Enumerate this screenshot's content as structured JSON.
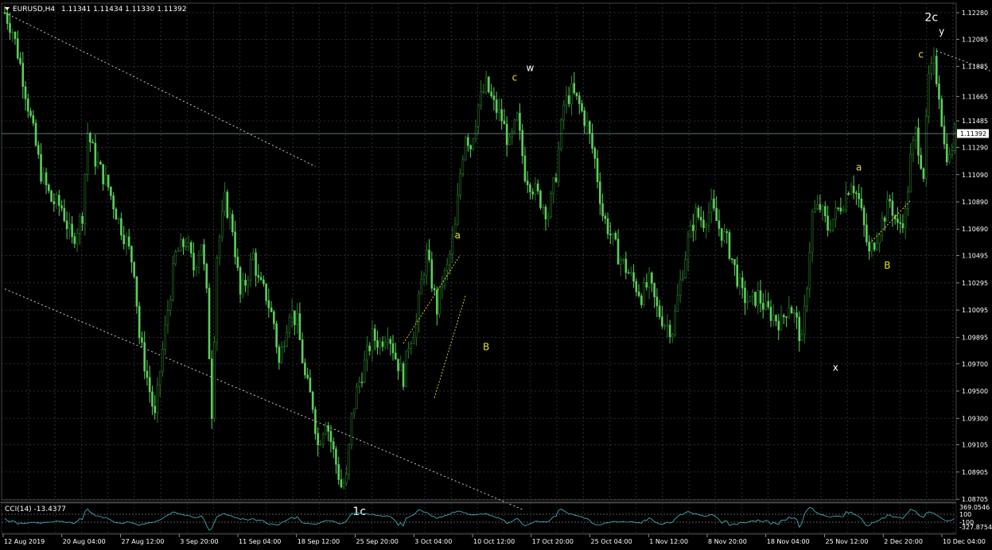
{
  "header": {
    "symbol_label": "EURUSD,H4",
    "ohlc": "1.11341 1.11434 1.11330 1.11392"
  },
  "indicator": {
    "label": "CCI(14) -13.4377",
    "top_value": "369.0546",
    "level_hi": "100",
    "level_lo": "-100",
    "bottom_value": "-327.8754",
    "color": "#4ab8c8"
  },
  "colors": {
    "background": "#000000",
    "grid": "#3a3a3a",
    "bull_candle": "#2a7a2a",
    "bear_candle": "#5ccf5c",
    "text": "#ffffff",
    "wave_minor": "#e8e030",
    "wave_major": "#ffffff"
  },
  "chart_data": {
    "type": "candlestick",
    "symbol": "EURUSD",
    "timeframe": "H4",
    "last_price": "1.11392",
    "ylim": [
      1.087,
      1.1235
    ],
    "y_ticks": [
      "1.12280",
      "1.12085",
      "1.11885",
      "1.11665",
      "1.11485",
      "1.11290",
      "1.11090",
      "1.10890",
      "1.10690",
      "1.10495",
      "1.10295",
      "1.10095",
      "1.09895",
      "1.09700",
      "1.09500",
      "1.09300",
      "1.09105",
      "1.08905",
      "1.08705"
    ],
    "x_ticks": [
      "12 Aug 2019",
      "20 Aug 04:00",
      "27 Aug 12:00",
      "3 Sep 20:00",
      "11 Sep 04:00",
      "18 Sep 12:00",
      "25 Sep 20:00",
      "3 Oct 04:00",
      "10 Oct 12:00",
      "17 Oct 20:00",
      "25 Oct 04:00",
      "1 Nov 12:00",
      "8 Nov 20:00",
      "18 Nov 04:00",
      "25 Nov 12:00",
      "2 Dec 20:00",
      "10 Dec 04:00"
    ],
    "price_path": [
      [
        0,
        1.1228
      ],
      [
        3,
        1.1215
      ],
      [
        6,
        1.119
      ],
      [
        10,
        1.115
      ],
      [
        14,
        1.111
      ],
      [
        18,
        1.109
      ],
      [
        22,
        1.1085
      ],
      [
        26,
        1.106
      ],
      [
        30,
        1.108
      ],
      [
        32,
        1.114
      ],
      [
        35,
        1.112
      ],
      [
        40,
        1.11
      ],
      [
        44,
        1.1075
      ],
      [
        47,
        1.106
      ],
      [
        50,
        1.104
      ],
      [
        52,
        1.099
      ],
      [
        55,
        1.096
      ],
      [
        58,
        1.093
      ],
      [
        60,
        1.0965
      ],
      [
        63,
        1.101
      ],
      [
        66,
        1.105
      ],
      [
        70,
        1.106
      ],
      [
        73,
        1.104
      ],
      [
        76,
        1.106
      ],
      [
        78,
        1.102
      ],
      [
        80,
        1.0935
      ],
      [
        82,
        1.105
      ],
      [
        85,
        1.109
      ],
      [
        88,
        1.107
      ],
      [
        91,
        1.102
      ],
      [
        93,
        1.103
      ],
      [
        96,
        1.105
      ],
      [
        98,
        1.103
      ],
      [
        101,
        1.102
      ],
      [
        104,
        1.1
      ],
      [
        106,
        1.097
      ],
      [
        110,
        1.101
      ],
      [
        113,
        1.1
      ],
      [
        116,
        1.096
      ],
      [
        119,
        1.094
      ],
      [
        121,
        1.091
      ],
      [
        124,
        1.093
      ],
      [
        127,
        1.0905
      ],
      [
        130,
        1.088
      ],
      [
        132,
        1.0885
      ],
      [
        134,
        1.093
      ],
      [
        136,
        1.095
      ],
      [
        139,
        1.097
      ],
      [
        142,
        1.099
      ],
      [
        145,
        1.0985
      ],
      [
        148,
        1.0995
      ],
      [
        151,
        1.0975
      ],
      [
        154,
        1.096
      ],
      [
        156,
        1.0985
      ],
      [
        159,
        1.1
      ],
      [
        161,
        1.103
      ],
      [
        163,
        1.105
      ],
      [
        165,
        1.103
      ],
      [
        167,
        1.101
      ],
      [
        169,
        1.103
      ],
      [
        171,
        1.104
      ],
      [
        174,
        1.107
      ],
      [
        176,
        1.111
      ],
      [
        178,
        1.114
      ],
      [
        180,
        1.113
      ],
      [
        183,
        1.116
      ],
      [
        186,
        1.1175
      ],
      [
        189,
        1.116
      ],
      [
        192,
        1.115
      ],
      [
        195,
        1.113
      ],
      [
        198,
        1.115
      ],
      [
        201,
        1.111
      ],
      [
        204,
        1.11
      ],
      [
        207,
        1.109
      ],
      [
        210,
        1.108
      ],
      [
        213,
        1.111
      ],
      [
        216,
        1.116
      ],
      [
        219,
        1.117
      ],
      [
        222,
        1.116
      ],
      [
        225,
        1.1145
      ],
      [
        228,
        1.112
      ],
      [
        231,
        1.108
      ],
      [
        234,
        1.1065
      ],
      [
        237,
        1.105
      ],
      [
        240,
        1.104
      ],
      [
        243,
        1.103
      ],
      [
        246,
        1.102
      ],
      [
        249,
        1.103
      ],
      [
        252,
        1.101
      ],
      [
        255,
        1.1
      ],
      [
        258,
        1.0995
      ],
      [
        261,
        1.103
      ],
      [
        264,
        1.106
      ],
      [
        267,
        1.108
      ],
      [
        270,
        1.1075
      ],
      [
        273,
        1.1085
      ],
      [
        276,
        1.107
      ],
      [
        279,
        1.106
      ],
      [
        282,
        1.104
      ],
      [
        285,
        1.102
      ],
      [
        288,
        1.1015
      ],
      [
        291,
        1.102
      ],
      [
        294,
        1.101
      ],
      [
        297,
        1.1005
      ],
      [
        300,
        1.1
      ],
      [
        303,
        1.1015
      ],
      [
        306,
        1.1
      ],
      [
        308,
        1.0985
      ],
      [
        310,
        1.103
      ],
      [
        312,
        1.108
      ],
      [
        315,
        1.1085
      ],
      [
        318,
        1.107
      ],
      [
        321,
        1.108
      ],
      [
        324,
        1.109
      ],
      [
        327,
        1.1105
      ],
      [
        330,
        1.109
      ],
      [
        332,
        1.107
      ],
      [
        334,
        1.105
      ],
      [
        336,
        1.106
      ],
      [
        339,
        1.1075
      ],
      [
        342,
        1.109
      ],
      [
        345,
        1.107
      ],
      [
        348,
        1.108
      ],
      [
        350,
        1.112
      ],
      [
        352,
        1.114
      ],
      [
        355,
        1.111
      ],
      [
        357,
        1.118
      ],
      [
        359,
        1.119
      ],
      [
        361,
        1.117
      ],
      [
        363,
        1.113
      ],
      [
        365,
        1.112
      ],
      [
        367,
        1.114
      ]
    ],
    "series_length": 368,
    "channel_lines": [
      {
        "from": [
          0,
          1.1228
        ],
        "to": [
          120,
          1.1115
        ],
        "style": "dotted"
      },
      {
        "from": [
          0,
          1.1025
        ],
        "to": [
          200,
          1.0863
        ],
        "style": "dotted"
      },
      {
        "from": [
          360,
          1.12
        ],
        "to": [
          420,
          1.1157
        ],
        "style": "dotted"
      }
    ],
    "wave_links": [
      {
        "from": [
          154,
          1.0985
        ],
        "to": [
          176,
          1.105
        ],
        "color": "wave_minor"
      },
      {
        "from": [
          166,
          1.0945
        ],
        "to": [
          178,
          1.102
        ],
        "color": "wave_minor"
      },
      {
        "from": [
          335,
          1.106
        ],
        "to": [
          350,
          1.109
        ],
        "color": "wave_minor"
      }
    ],
    "wave_labels": [
      {
        "text": "1c",
        "at": [
          137,
          1.0859
        ],
        "color": "wave_major"
      },
      {
        "text": "a",
        "at": [
          175,
          1.1062
        ],
        "color": "wave_minor"
      },
      {
        "text": "B",
        "at": [
          186,
          1.098
        ],
        "color": "wave_minor"
      },
      {
        "text": "c",
        "at": [
          197,
          1.1178
        ],
        "color": "wave_minor"
      },
      {
        "text": "w",
        "at": [
          203,
          1.1185
        ],
        "color": "wave_major"
      },
      {
        "text": "x",
        "at": [
          321,
          1.0965
        ],
        "color": "wave_major"
      },
      {
        "text": "a",
        "at": [
          330,
          1.1112
        ],
        "color": "wave_minor"
      },
      {
        "text": "B",
        "at": [
          341,
          1.104
        ],
        "color": "wave_minor"
      },
      {
        "text": "c",
        "at": [
          354,
          1.1195
        ],
        "color": "wave_minor"
      },
      {
        "text": "2c",
        "at": [
          358,
          1.1222
        ],
        "color": "wave_major"
      },
      {
        "text": "y",
        "at": [
          362,
          1.1212
        ],
        "color": "wave_major"
      }
    ]
  }
}
